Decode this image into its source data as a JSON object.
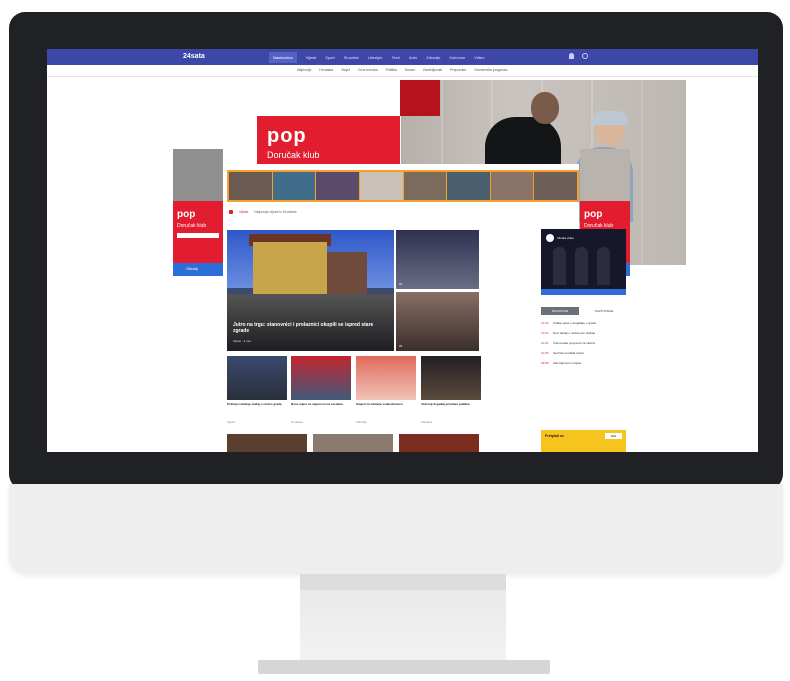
{
  "site": {
    "logo": "24sata",
    "nav": [
      "Naslovnica",
      "Vijesti",
      "Sport",
      "Showbiz",
      "Lifestyle",
      "Tech",
      "Auto",
      "Zdravlje",
      "Kolumne",
      "Video"
    ],
    "sub_nav": [
      "Najnovije",
      "Hrvatska",
      "Svijet",
      "Crna kronika",
      "Politika",
      "Novac",
      "Zanimljivosti",
      "Preporuke",
      "Vremenska prognoza"
    ]
  },
  "ad": {
    "brand": "pop",
    "tagline": "Doručak klub",
    "side_tagline": "Doručak klub",
    "cta": "Gledaj",
    "accent": "#e21d2f"
  },
  "breadcrumb": [
    "Vijesti",
    "Najnovije vijesti iz Hrvatske"
  ],
  "main_story": {
    "title": "Jutro na trgu: stanovnici i prolaznici okupili se ispred stare zgrade",
    "meta": "Vijesti · 2 min"
  },
  "side_stories": [
    {
      "chip": "24"
    },
    {
      "chip": "24"
    }
  ],
  "cards": [
    {
      "title": "Policija istražuje slučaj u centru grada",
      "meta": "Vijesti"
    },
    {
      "title": "Nove mjere za sigurnost na cestama",
      "meta": "Hrvatska"
    },
    {
      "title": "Savjeti za zdraviju svakodnevicu",
      "meta": "Zdravlje"
    },
    {
      "title": "Večernji događaj privukao publiku",
      "meta": "Showbiz"
    }
  ],
  "right_col": {
    "video_title": "24sata video",
    "tabs": [
      "NAJNOVIJE",
      "NAJČITANIJE"
    ],
    "latest": [
      {
        "time": "10:40",
        "text": "Kratka vijest o događaju u gradu"
      },
      {
        "time": "10:32",
        "text": "Novi detalji o nedavnom slučaju"
      },
      {
        "time": "10:21",
        "text": "Vremenska prognoza za vikend"
      },
      {
        "time": "10:05",
        "text": "Sportski rezultati večeri"
      },
      {
        "time": "09:58",
        "text": "Zanimljivost iz svijeta"
      }
    ],
    "promo_text": "Pretplati se",
    "promo_btn": "Više"
  },
  "icons": {
    "search": "search-icon",
    "user": "user-icon"
  },
  "colors": {
    "nav": "#3c47a8",
    "brand_red": "#e21d2f",
    "promo_yellow": "#f7c31e"
  }
}
